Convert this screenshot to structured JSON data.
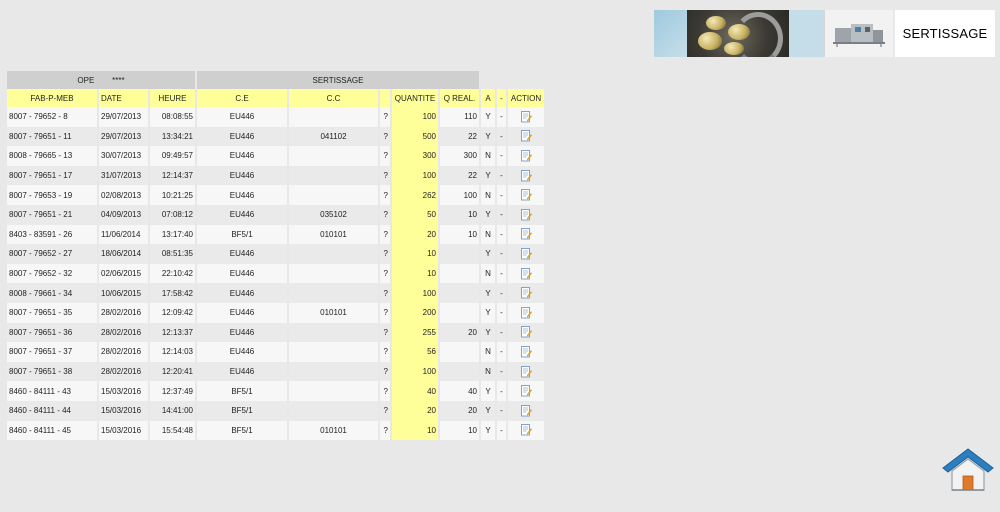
{
  "header": {
    "brand_label": "SERTISSAGE",
    "photo1_icon": "cans-photo-icon",
    "photo2_icon": "machine-photo-icon"
  },
  "sections": {
    "ope_label": "OPE",
    "ope_mask": "****",
    "sertissage_label": "SERTISSAGE"
  },
  "columns": [
    "FAB-P-MEB",
    "DATE",
    "HEURE",
    "C.E",
    "C.C",
    "",
    "QUANTITE",
    "Q REAL.",
    "A",
    "-",
    "ACTION"
  ],
  "rows": [
    {
      "fab": "8007 - 79652 - 8",
      "date": "29/07/2013",
      "heure": "08:08:55",
      "ce": "EU446",
      "cc": "",
      "q": "?",
      "qte": "100",
      "qreal": "110",
      "a": "Y",
      "dash": "-"
    },
    {
      "fab": "8007 - 79651 - 11",
      "date": "29/07/2013",
      "heure": "13:34:21",
      "ce": "EU446",
      "cc": "041102",
      "q": "?",
      "qte": "500",
      "qreal": "22",
      "a": "Y",
      "dash": "-"
    },
    {
      "fab": "8008 - 79665 - 13",
      "date": "30/07/2013",
      "heure": "09:49:57",
      "ce": "EU446",
      "cc": "",
      "q": "?",
      "qte": "300",
      "qreal": "300",
      "a": "N",
      "dash": "-"
    },
    {
      "fab": "8007 - 79651 - 17",
      "date": "31/07/2013",
      "heure": "12:14:37",
      "ce": "EU446",
      "cc": "",
      "q": "?",
      "qte": "100",
      "qreal": "22",
      "a": "Y",
      "dash": "-"
    },
    {
      "fab": "8007 - 79653 - 19",
      "date": "02/08/2013",
      "heure": "10:21:25",
      "ce": "EU446",
      "cc": "",
      "q": "?",
      "qte": "262",
      "qreal": "100",
      "a": "N",
      "dash": "-"
    },
    {
      "fab": "8007 - 79651 - 21",
      "date": "04/09/2013",
      "heure": "07:08:12",
      "ce": "EU446",
      "cc": "035102",
      "q": "?",
      "qte": "50",
      "qreal": "10",
      "a": "Y",
      "dash": "-"
    },
    {
      "fab": "8403 - 83591 - 26",
      "date": "11/06/2014",
      "heure": "13:17:40",
      "ce": "BF5/1",
      "cc": "010101",
      "q": "?",
      "qte": "20",
      "qreal": "10",
      "a": "N",
      "dash": "-"
    },
    {
      "fab": "8007 - 79652 - 27",
      "date": "18/06/2014",
      "heure": "08:51:35",
      "ce": "EU446",
      "cc": "",
      "q": "?",
      "qte": "10",
      "qreal": "",
      "a": "Y",
      "dash": "-"
    },
    {
      "fab": "8007 - 79652 - 32",
      "date": "02/06/2015",
      "heure": "22:10:42",
      "ce": "EU446",
      "cc": "",
      "q": "?",
      "qte": "10",
      "qreal": "",
      "a": "N",
      "dash": "-"
    },
    {
      "fab": "8008 - 79661 - 34",
      "date": "10/06/2015",
      "heure": "17:58:42",
      "ce": "EU446",
      "cc": "",
      "q": "?",
      "qte": "100",
      "qreal": "",
      "a": "Y",
      "dash": "-"
    },
    {
      "fab": "8007 - 79651 - 35",
      "date": "28/02/2016",
      "heure": "12:09:42",
      "ce": "EU446",
      "cc": "010101",
      "q": "?",
      "qte": "200",
      "qreal": "",
      "a": "Y",
      "dash": "-"
    },
    {
      "fab": "8007 - 79651 - 36",
      "date": "28/02/2016",
      "heure": "12:13:37",
      "ce": "EU446",
      "cc": "",
      "q": "?",
      "qte": "255",
      "qreal": "20",
      "a": "Y",
      "dash": "-"
    },
    {
      "fab": "8007 - 79651 - 37",
      "date": "28/02/2016",
      "heure": "12:14:03",
      "ce": "EU446",
      "cc": "",
      "q": "?",
      "qte": "56",
      "qreal": "",
      "a": "N",
      "dash": "-"
    },
    {
      "fab": "8007 - 79651 - 38",
      "date": "28/02/2016",
      "heure": "12:20:41",
      "ce": "EU446",
      "cc": "",
      "q": "?",
      "qte": "100",
      "qreal": "",
      "a": "N",
      "dash": "-"
    },
    {
      "fab": "8460 - 84111 - 43",
      "date": "15/03/2016",
      "heure": "12:37:49",
      "ce": "BF5/1",
      "cc": "",
      "q": "?",
      "qte": "40",
      "qreal": "40",
      "a": "Y",
      "dash": "-"
    },
    {
      "fab": "8460 - 84111 - 44",
      "date": "15/03/2016",
      "heure": "14:41:00",
      "ce": "BF5/1",
      "cc": "",
      "q": "?",
      "qte": "20",
      "qreal": "20",
      "a": "Y",
      "dash": "-"
    },
    {
      "fab": "8460 - 84111 - 45",
      "date": "15/03/2016",
      "heure": "15:54:48",
      "ce": "BF5/1",
      "cc": "010101",
      "q": "?",
      "qte": "10",
      "qreal": "10",
      "a": "Y",
      "dash": "-"
    }
  ],
  "action_icon": "edit-document-icon",
  "home_icon": "home-icon",
  "colors": {
    "background": "#e8e8e8",
    "header_yellow": "#ffff99",
    "section_gray": "#cfcfcf",
    "home_blue": "#2b7fc0",
    "home_door": "#e07b2e"
  }
}
